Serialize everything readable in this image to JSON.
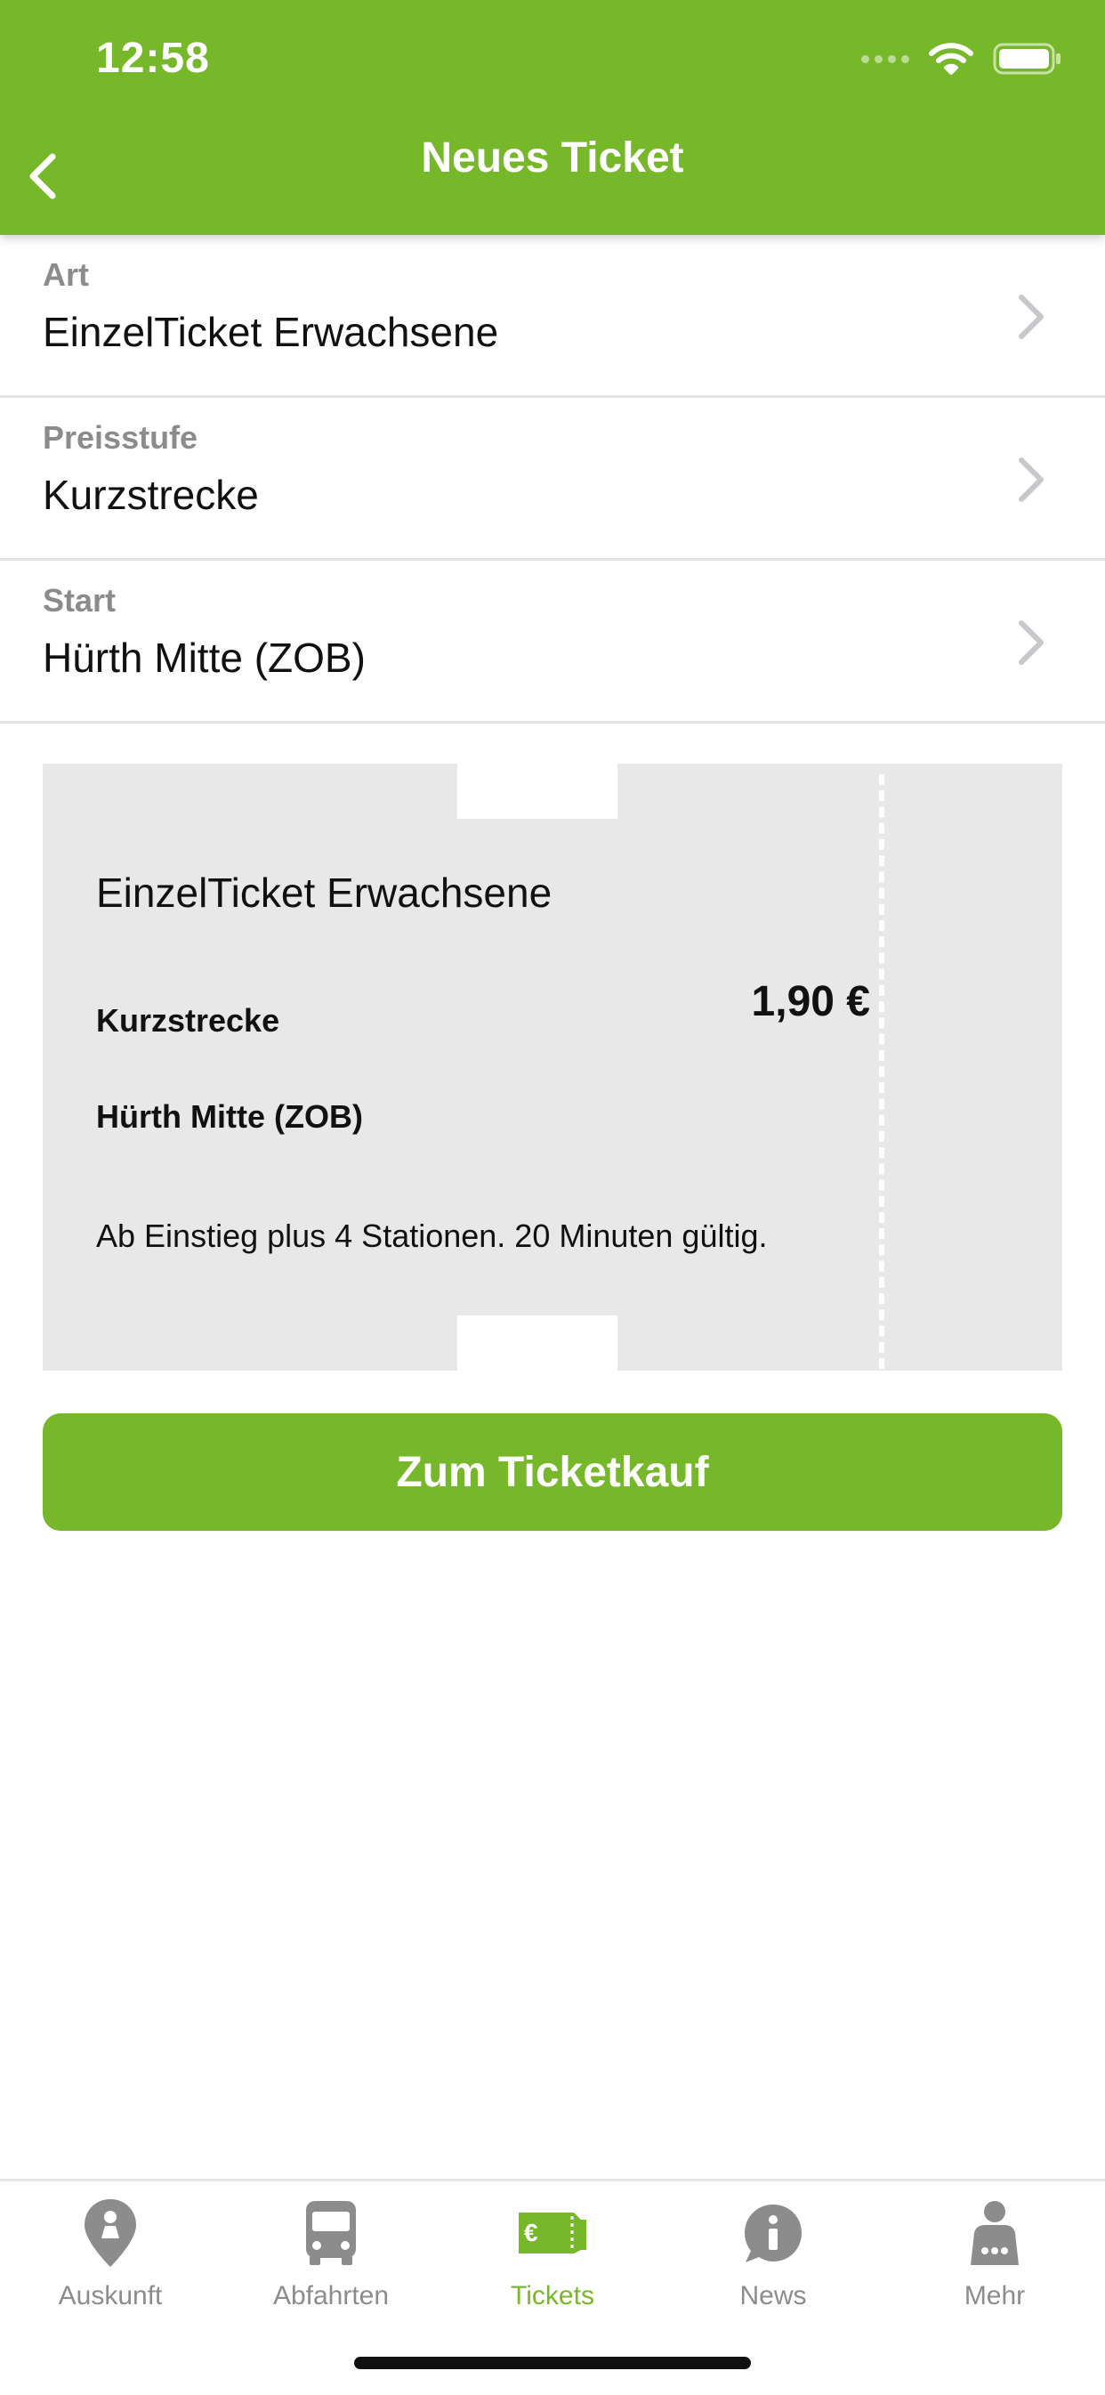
{
  "status_bar": {
    "time": "12:58"
  },
  "nav": {
    "title": "Neues Ticket",
    "back_icon": "chevron-left-icon"
  },
  "form": {
    "rows": [
      {
        "label": "Art",
        "value": "EinzelTicket Erwachsene"
      },
      {
        "label": "Preisstufe",
        "value": "Kurzstrecke"
      },
      {
        "label": "Start",
        "value": "Hürth Mitte (ZOB)"
      }
    ]
  },
  "ticket": {
    "name": "EinzelTicket Erwachsene",
    "zone": "Kurzstrecke",
    "price": "1,90 €",
    "start": "Hürth Mitte (ZOB)",
    "description": "Ab Einstieg plus 4 Stationen. 20 Minuten gültig."
  },
  "buy_button": {
    "label": "Zum Ticketkauf"
  },
  "tabbar": {
    "items": [
      {
        "label": "Auskunft",
        "icon": "location-pin-icon",
        "active": false
      },
      {
        "label": "Abfahrten",
        "icon": "bus-icon",
        "active": false
      },
      {
        "label": "Tickets",
        "icon": "ticket-euro-icon",
        "active": true
      },
      {
        "label": "News",
        "icon": "info-bubble-icon",
        "active": false
      },
      {
        "label": "Mehr",
        "icon": "person-more-icon",
        "active": false
      }
    ]
  },
  "colors": {
    "accent": "#77b82a",
    "ticket_bg": "#e8e8e8",
    "inactive_tab": "#8c8c8c"
  }
}
